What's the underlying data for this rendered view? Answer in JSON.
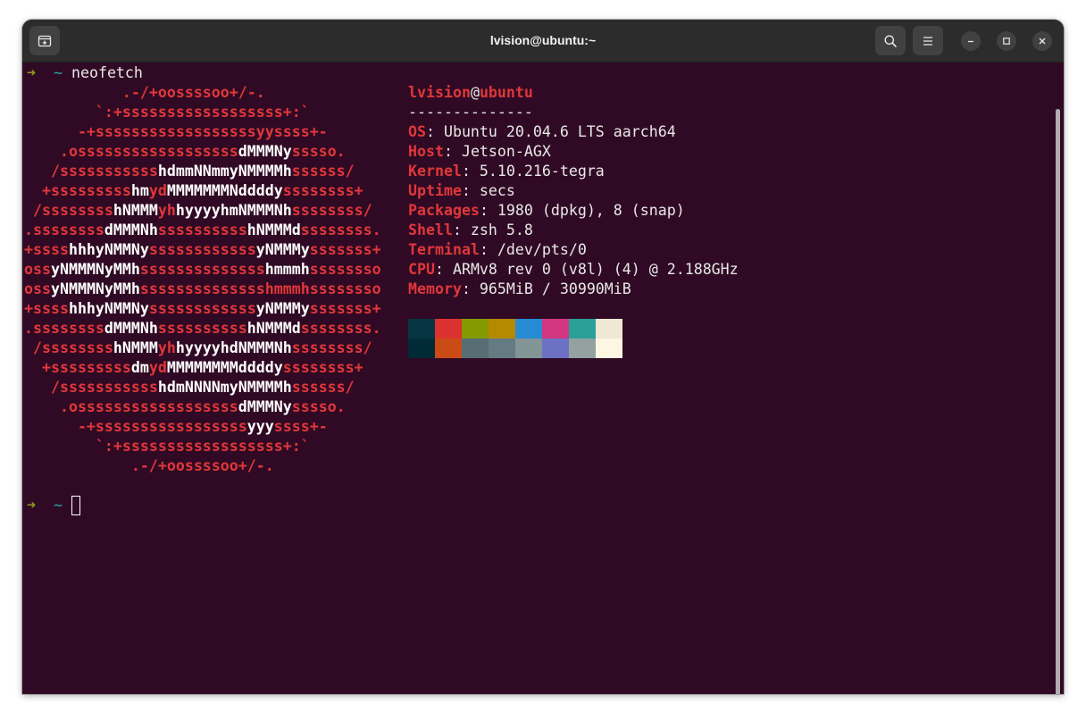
{
  "window": {
    "title": "lvision@ubuntu:~"
  },
  "titlebar_icons": {
    "new_tab": "new-tab-icon",
    "search": "search-icon",
    "menu": "hamburger-menu-icon",
    "minimize": "minimize-icon",
    "maximize": "maximize-icon",
    "close": "close-icon"
  },
  "prompt": {
    "arrow": "➜",
    "dir": "~",
    "command": "neofetch"
  },
  "logo_lines": [
    [
      [
        "r",
        "           .-/+oossssoo+/-."
      ]
    ],
    [
      [
        "r",
        "        `:+ssssssssssssssssss+:`"
      ]
    ],
    [
      [
        "r",
        "      -+ssssssssssssssssssyyssss+-"
      ]
    ],
    [
      [
        "r",
        "    .ossssssssssssssssss"
      ],
      [
        "w",
        "dMMMNy"
      ],
      [
        "r",
        "sssso."
      ]
    ],
    [
      [
        "r",
        "   /sssssssssss"
      ],
      [
        "w",
        "hdmmNNmmyNMMMMh"
      ],
      [
        "r",
        "ssssss/"
      ]
    ],
    [
      [
        "r",
        "  +sssssssss"
      ],
      [
        "w",
        "hm"
      ],
      [
        "r",
        "yd"
      ],
      [
        "w",
        "MMMMMMMNddddy"
      ],
      [
        "r",
        "ssssssss+"
      ]
    ],
    [
      [
        "r",
        " /ssssssss"
      ],
      [
        "w",
        "hNMMM"
      ],
      [
        "r",
        "yh"
      ],
      [
        "w",
        "hyyyyhmNMMMNh"
      ],
      [
        "r",
        "ssssssss/"
      ]
    ],
    [
      [
        "r",
        ".ssssssss"
      ],
      [
        "w",
        "dMMMNh"
      ],
      [
        "r",
        "ssssssssss"
      ],
      [
        "w",
        "hNMMMd"
      ],
      [
        "r",
        "ssssssss."
      ]
    ],
    [
      [
        "r",
        "+ssss"
      ],
      [
        "w",
        "hhhyNMMNy"
      ],
      [
        "r",
        "ssssssssssss"
      ],
      [
        "w",
        "yNMMMy"
      ],
      [
        "r",
        "sssssss+"
      ]
    ],
    [
      [
        "r",
        "oss"
      ],
      [
        "w",
        "yNMMMNyMMh"
      ],
      [
        "r",
        "ssssssssssssss"
      ],
      [
        "w",
        "hmmmh"
      ],
      [
        "r",
        "ssssssso"
      ]
    ],
    [
      [
        "r",
        "oss"
      ],
      [
        "w",
        "yNMMMNyMMh"
      ],
      [
        "r",
        "sssssssssssssshmmmhssssssso"
      ]
    ],
    [
      [
        "r",
        "+ssss"
      ],
      [
        "w",
        "hhhyNMMNy"
      ],
      [
        "r",
        "ssssssssssss"
      ],
      [
        "w",
        "yNMMMy"
      ],
      [
        "r",
        "sssssss+"
      ]
    ],
    [
      [
        "r",
        ".ssssssss"
      ],
      [
        "w",
        "dMMMNh"
      ],
      [
        "r",
        "ssssssssss"
      ],
      [
        "w",
        "hNMMMd"
      ],
      [
        "r",
        "ssssssss."
      ]
    ],
    [
      [
        "r",
        " /ssssssss"
      ],
      [
        "w",
        "hNMMM"
      ],
      [
        "r",
        "yh"
      ],
      [
        "w",
        "hyyyyhdNMMMNh"
      ],
      [
        "r",
        "ssssssss/"
      ]
    ],
    [
      [
        "r",
        "  +sssssssss"
      ],
      [
        "w",
        "dm"
      ],
      [
        "r",
        "yd"
      ],
      [
        "w",
        "MMMMMMMMddddy"
      ],
      [
        "r",
        "ssssssss+"
      ]
    ],
    [
      [
        "r",
        "   /sssssssssss"
      ],
      [
        "w",
        "hdmNNNNmyNMMMMh"
      ],
      [
        "r",
        "ssssss/"
      ]
    ],
    [
      [
        "r",
        "    .ossssssssssssssssss"
      ],
      [
        "w",
        "dMMMNy"
      ],
      [
        "r",
        "sssso."
      ]
    ],
    [
      [
        "r",
        "      -+sssssssssssssssss"
      ],
      [
        "w",
        "yyy"
      ],
      [
        "r",
        "ssss+-"
      ]
    ],
    [
      [
        "r",
        "        `:+ssssssssssssssssss+:`"
      ]
    ],
    [
      [
        "r",
        "            .-/+oossssoo+/-."
      ]
    ]
  ],
  "sysinfo": {
    "user": "lvision",
    "at": "@",
    "host": "ubuntu",
    "separator": "--------------",
    "rows": [
      {
        "label": "OS",
        "value": ": Ubuntu 20.04.6 LTS aarch64"
      },
      {
        "label": "Host",
        "value": ": Jetson-AGX"
      },
      {
        "label": "Kernel",
        "value": ": 5.10.216-tegra"
      },
      {
        "label": "Uptime",
        "value": ": secs"
      },
      {
        "label": "Packages",
        "value": ": 1980 (dpkg), 8 (snap)"
      },
      {
        "label": "Shell",
        "value": ": zsh 5.8"
      },
      {
        "label": "Terminal",
        "value": ": /dev/pts/0"
      },
      {
        "label": "CPU",
        "value": ": ARMv8 rev 0 (v8l) (4) @ 2.188GHz"
      },
      {
        "label": "Memory",
        "value": ": 965MiB / 30990MiB"
      }
    ]
  },
  "palette": {
    "top": [
      "#073642",
      "#dc322f",
      "#859900",
      "#b58900",
      "#268bd2",
      "#d33682",
      "#2aa198",
      "#eee8d5"
    ],
    "bottom": [
      "#002b36",
      "#cb4b16",
      "#586e75",
      "#657b83",
      "#839496",
      "#6c71c4",
      "#93a1a1",
      "#fdf6e3"
    ]
  },
  "colors": {
    "terminal_bg": "#300a24",
    "logo_red": "#e0373a",
    "prompt_arrow": "#8f9d1c",
    "prompt_dir": "#2fa6a3",
    "titlebar_bg": "#2c2c2c"
  }
}
